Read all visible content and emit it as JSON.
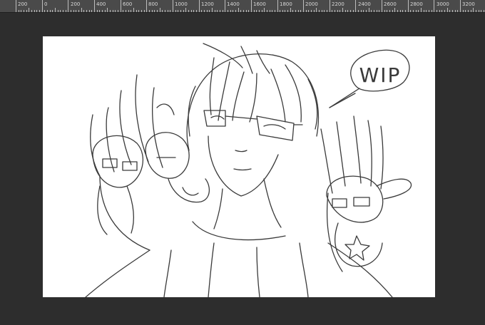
{
  "ruler": {
    "ticks": [
      {
        "label": "200"
      },
      {
        "label": "0"
      },
      {
        "label": "200"
      },
      {
        "label": "400"
      },
      {
        "label": "600"
      },
      {
        "label": "800"
      },
      {
        "label": "1000"
      },
      {
        "label": "1200"
      },
      {
        "label": "1400"
      },
      {
        "label": "1600"
      },
      {
        "label": "1800"
      },
      {
        "label": "2000"
      },
      {
        "label": "2200"
      },
      {
        "label": "2400"
      },
      {
        "label": "2600"
      },
      {
        "label": "2800"
      },
      {
        "label": "3000"
      },
      {
        "label": "3200"
      }
    ]
  },
  "canvas": {
    "speech_bubble_text": "WIP"
  },
  "colors": {
    "workspace": "#2d2d2d",
    "ruler": "#4a4a4a",
    "paper": "#ffffff",
    "line_art": "#3a3a3a"
  }
}
